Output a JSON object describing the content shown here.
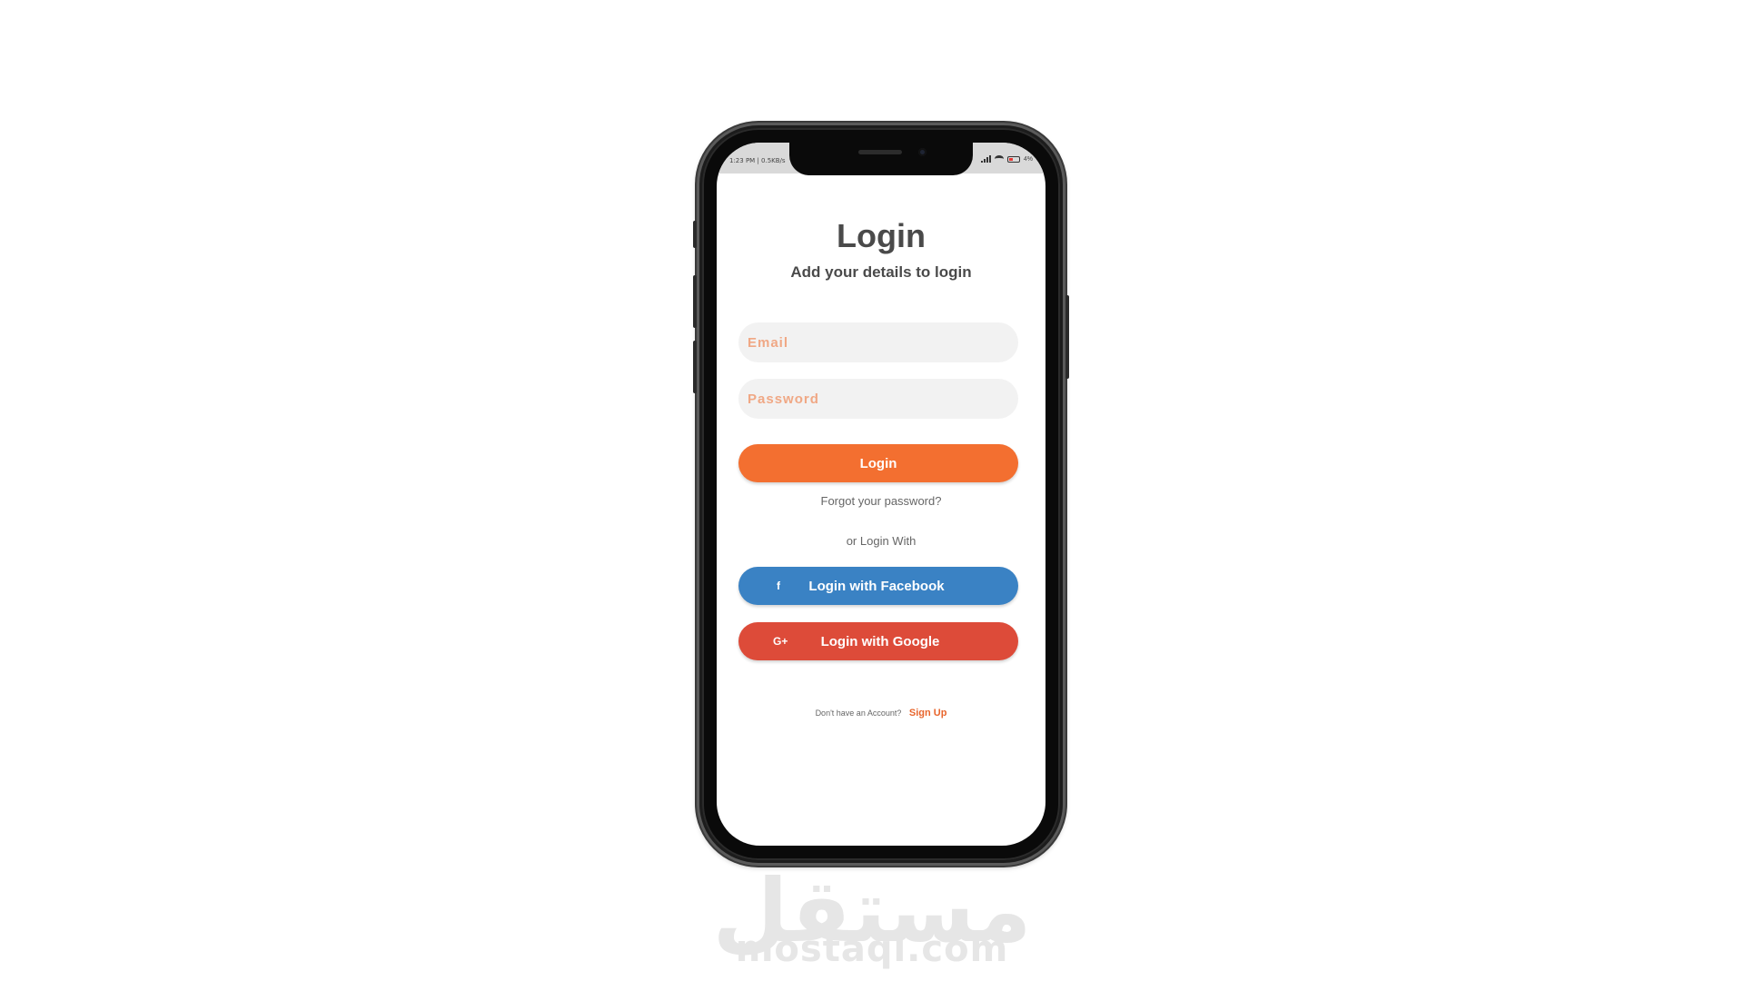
{
  "status_bar": {
    "time_speed": "1:23 PM | 0.5KB/s",
    "battery": "4%"
  },
  "login_screen": {
    "title": "Login",
    "subtitle": "Add your details to login",
    "email_placeholder": "Email",
    "password_placeholder": "Password",
    "login_button": "Login",
    "forgot_password": "Forgot your password?",
    "or_login_with": "or Login With",
    "facebook_icon": "f",
    "facebook_button": "Login with Facebook",
    "google_icon": "G+",
    "google_button": "Login with Google",
    "no_account": "Don't have an Account?",
    "sign_up": "Sign Up"
  },
  "colors": {
    "accent": "#f36f30",
    "facebook": "#3a82c4",
    "google": "#dd4b39",
    "placeholder": "#f0a885"
  },
  "watermark": {
    "arabic": "مستقل",
    "latin": "mostaql.com"
  }
}
